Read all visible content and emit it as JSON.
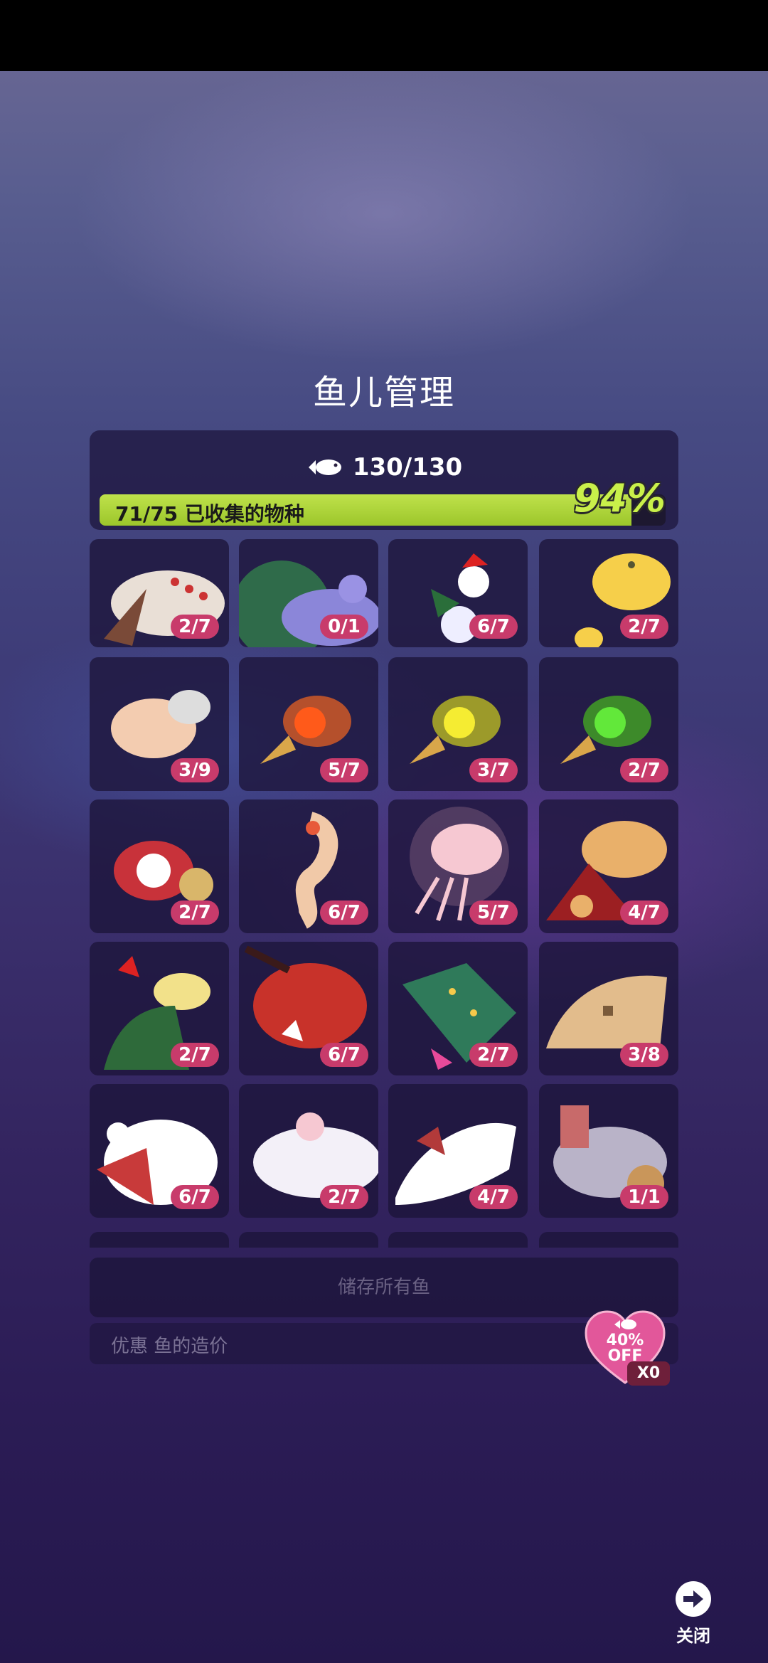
{
  "title": "鱼儿管理",
  "fish_count": "130/130",
  "species": {
    "label": "71/75 已收集的物种",
    "percent_text": "94%",
    "progress": 0.94
  },
  "tiles": [
    {
      "badge": "2/7"
    },
    {
      "badge": "0/1"
    },
    {
      "badge": "6/7"
    },
    {
      "badge": "2/7"
    },
    {
      "badge": "3/9"
    },
    {
      "badge": "5/7"
    },
    {
      "badge": "3/7"
    },
    {
      "badge": "2/7"
    },
    {
      "badge": "2/7"
    },
    {
      "badge": "6/7"
    },
    {
      "badge": "5/7"
    },
    {
      "badge": "4/7"
    },
    {
      "badge": "2/7"
    },
    {
      "badge": "6/7"
    },
    {
      "badge": "2/7"
    },
    {
      "badge": "3/8"
    },
    {
      "badge": "6/7"
    },
    {
      "badge": "2/7"
    },
    {
      "badge": "4/7"
    },
    {
      "badge": "1/1"
    }
  ],
  "store_button": "储存所有鱼",
  "discount": {
    "label": "优惠 鱼的造价",
    "heart_line1": "40%",
    "heart_line2": "OFF",
    "multiplier": "X0"
  },
  "close_label": "关闭",
  "colors": {
    "badge": "#c83b6b",
    "progress": "#a9d13a",
    "panel": "#1c143a"
  }
}
